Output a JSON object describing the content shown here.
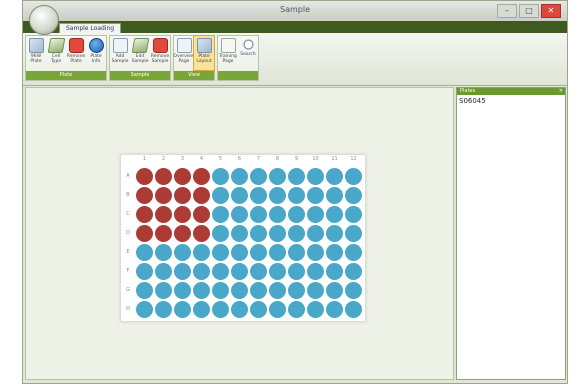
{
  "window": {
    "title": "Sample"
  },
  "tab": {
    "label": "Sample Loading"
  },
  "ribbon": {
    "groups": [
      {
        "label": "Plate",
        "buttons": [
          {
            "label": "96W Plate",
            "icon": "grid-plate-icon"
          },
          {
            "label": "Cell Type",
            "icon": "flask-icon"
          },
          {
            "label": "Remove Plate",
            "icon": "delete-icon"
          },
          {
            "label": "Plate Info",
            "icon": "info-icon"
          }
        ]
      },
      {
        "label": "Sample",
        "buttons": [
          {
            "label": "Add Sample",
            "icon": "add-sample-icon"
          },
          {
            "label": "Edit Sample",
            "icon": "edit-flask-icon"
          },
          {
            "label": "Remove Sample",
            "icon": "remove-sample-icon"
          }
        ]
      },
      {
        "label": "View",
        "buttons": [
          {
            "label": "Overview Page",
            "icon": "overview-icon"
          },
          {
            "label": "Plate Layout",
            "icon": "plate-layout-icon",
            "active": true
          }
        ]
      },
      {
        "label": "",
        "buttons": [
          {
            "label": "Training Page",
            "icon": "training-page-icon"
          },
          {
            "label": "Search",
            "icon": "search-icon"
          }
        ]
      }
    ]
  },
  "side_panel": {
    "header": "Plates",
    "items": [
      "S06045"
    ]
  },
  "plate": {
    "columns": [
      "1",
      "2",
      "3",
      "4",
      "5",
      "6",
      "7",
      "8",
      "9",
      "10",
      "11",
      "12"
    ],
    "rows": [
      "A",
      "B",
      "C",
      "D",
      "E",
      "F",
      "G",
      "H"
    ],
    "selected_block": {
      "rows": [
        "A",
        "B",
        "C",
        "D"
      ],
      "columns": [
        "1",
        "2",
        "3",
        "4"
      ]
    }
  },
  "colors": {
    "selected": "#ad3b35",
    "unselected": "#49a7c9",
    "accent": "#3e5a1f"
  }
}
